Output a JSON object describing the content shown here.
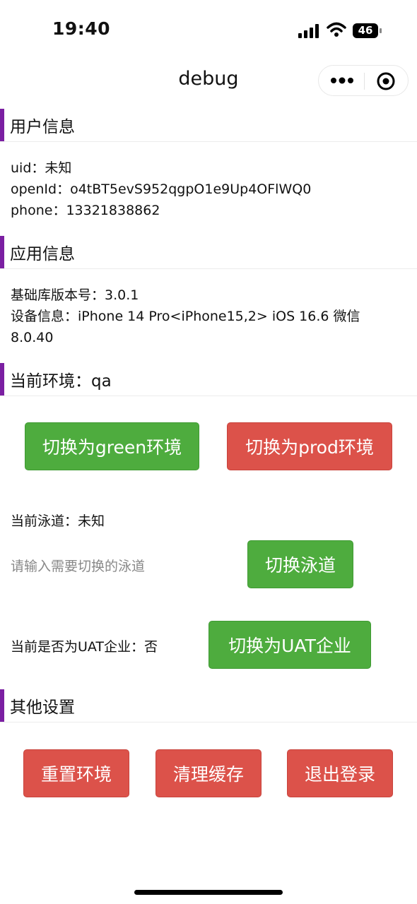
{
  "status_bar": {
    "time": "19:40",
    "battery": "46"
  },
  "nav": {
    "title": "debug"
  },
  "sections": {
    "user_info": "用户信息",
    "app_info": "应用信息",
    "current_env": "当前环境：qa",
    "other_settings": "其他设置"
  },
  "user": {
    "uid_line": "uid：未知",
    "openid_line": "openId：o4tBT5evS952qgpO1e9Up4OFlWQ0",
    "phone_line": "phone：13321838862"
  },
  "app": {
    "sdk_line": "基础库版本号：3.0.1",
    "device_line_1": "设备信息：iPhone 14 Pro<iPhone15,2> iOS 16.6 微信",
    "device_line_2": "8.0.40"
  },
  "env_buttons": {
    "green": "切换为green环境",
    "prod": "切换为prod环境"
  },
  "lane": {
    "current": "当前泳道：未知",
    "placeholder": "请输入需要切换的泳道",
    "switch_button": "切换泳道"
  },
  "uat": {
    "current": "当前是否为UAT企业：否",
    "switch_button": "切换为UAT企业"
  },
  "other_buttons": {
    "reset": "重置环境",
    "clear_cache": "清理缓存",
    "logout": "退出登录"
  },
  "colors": {
    "green": "#4eac3e",
    "red": "#dc524a",
    "section_accent": "#7b1fa2"
  }
}
